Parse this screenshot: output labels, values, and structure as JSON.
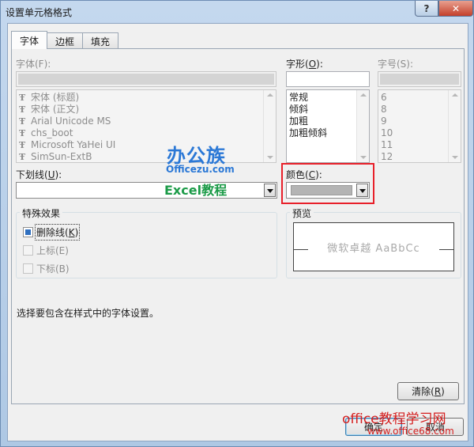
{
  "window": {
    "title": "设置单元格格式",
    "help": "?",
    "close": "✕"
  },
  "tabs": [
    {
      "label": "字体",
      "active": true
    },
    {
      "label": "边框",
      "active": false
    },
    {
      "label": "填充",
      "active": false
    }
  ],
  "font": {
    "label": "字体(F):",
    "input_value": "",
    "items": [
      "宋体 (标题)",
      "宋体 (正文)",
      "Arial Unicode MS",
      "chs_boot",
      "Microsoft YaHei UI",
      "SimSun-ExtB"
    ]
  },
  "style": {
    "label_pre": "字形(",
    "label_key": "O",
    "label_post": "):",
    "input_value": "",
    "items": [
      "常规",
      "倾斜",
      "加粗",
      "加粗倾斜"
    ]
  },
  "size": {
    "label": "字号(S):",
    "input_value": "",
    "items": [
      "6",
      "8",
      "9",
      "10",
      "11",
      "12"
    ]
  },
  "underline": {
    "label_pre": "下划线(",
    "label_key": "U",
    "label_post": "):",
    "value": ""
  },
  "color": {
    "label_pre": "颜色(",
    "label_key": "C",
    "label_post": "):",
    "swatch": "#b4b4b4",
    "highlight": "#e8202a"
  },
  "effects": {
    "title": "特殊效果",
    "strikethrough": {
      "label_pre": "删除线(",
      "label_key": "K",
      "label_post": ")",
      "state": "indeterminate"
    },
    "superscript": {
      "label": "上标(E)",
      "enabled": false
    },
    "subscript": {
      "label": "下标(B)",
      "enabled": false
    }
  },
  "preview": {
    "title": "预览",
    "sample": "微软卓越  AaBbCc"
  },
  "hint": "选择要包含在样式中的字体设置。",
  "clear_button": {
    "label_pre": "清除(",
    "label_key": "R",
    "label_post": ")"
  },
  "footer": {
    "ok": "确定",
    "cancel": "取消"
  },
  "watermarks": {
    "badge": "办公族",
    "site": "Officezu.com",
    "excel": "Excel教程",
    "office": "office教程学习网",
    "url": "www.office68.com"
  }
}
